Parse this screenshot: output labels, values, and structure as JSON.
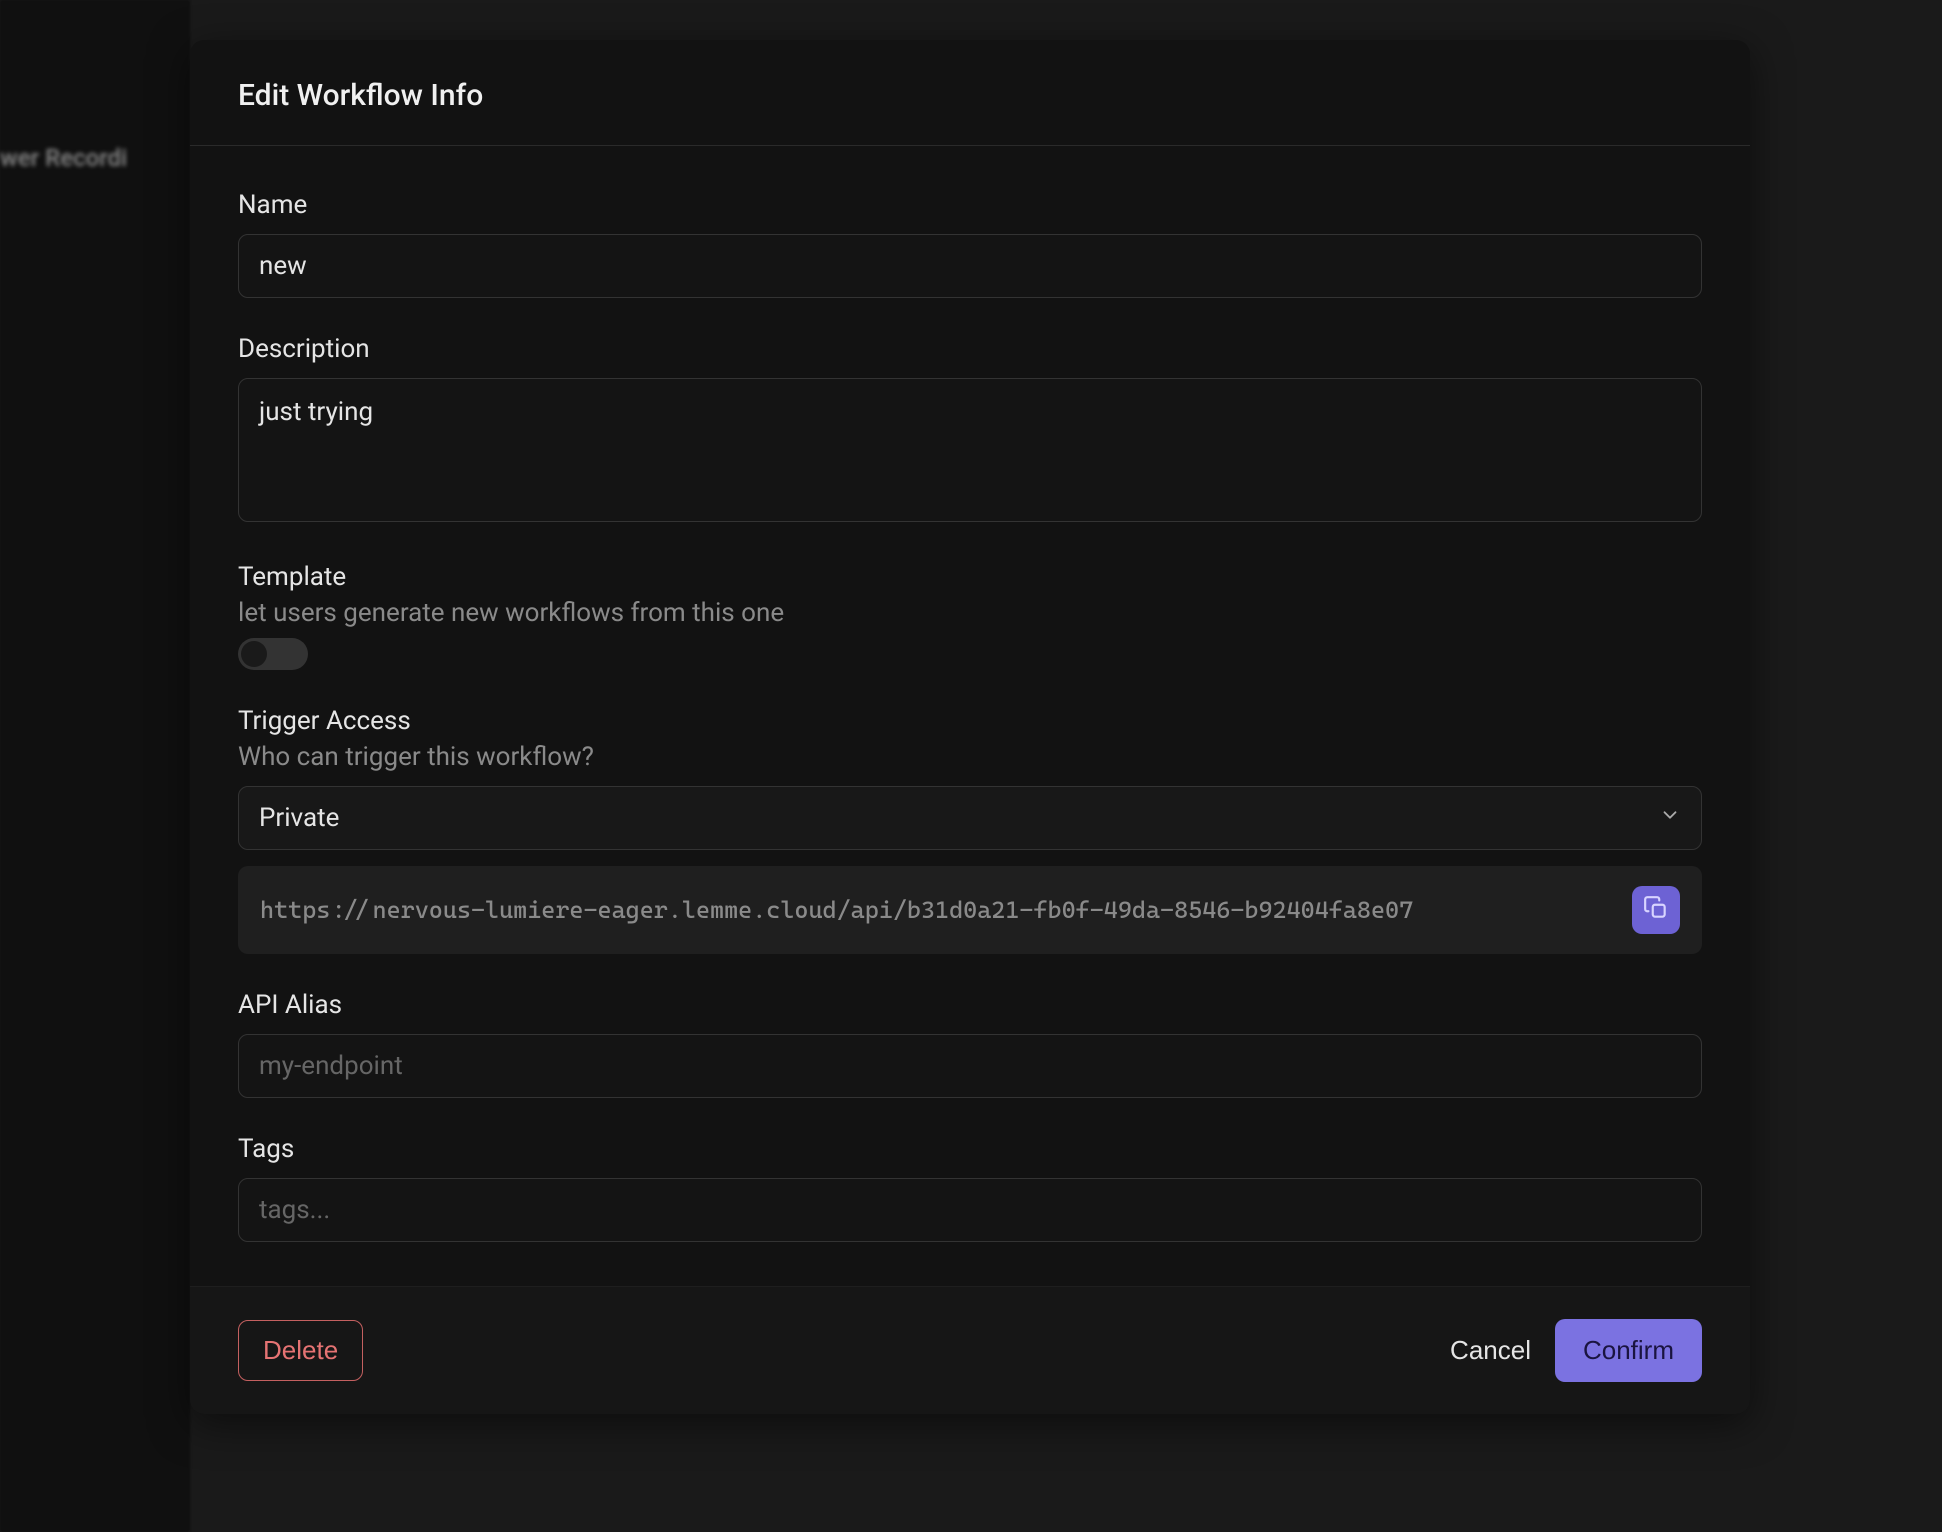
{
  "backdrop": {
    "label": "wer Recordi"
  },
  "modal": {
    "title": "Edit Workflow Info",
    "name": {
      "label": "Name",
      "value": "new"
    },
    "description": {
      "label": "Description",
      "value": "just trying"
    },
    "template": {
      "label": "Template",
      "sublabel": "let users generate new workflows from this one",
      "enabled": false
    },
    "trigger": {
      "label": "Trigger Access",
      "sublabel": "Who can trigger this workflow?",
      "selected": "Private",
      "url": "https://nervous-lumiere-eager.lemme.cloud/api/b31d0a21-fb0f-49da-8546-b92404fa8e07"
    },
    "apiAlias": {
      "label": "API Alias",
      "placeholder": "my-endpoint",
      "value": ""
    },
    "tags": {
      "label": "Tags",
      "placeholder": "tags...",
      "value": ""
    },
    "footer": {
      "delete": "Delete",
      "cancel": "Cancel",
      "confirm": "Confirm"
    }
  }
}
